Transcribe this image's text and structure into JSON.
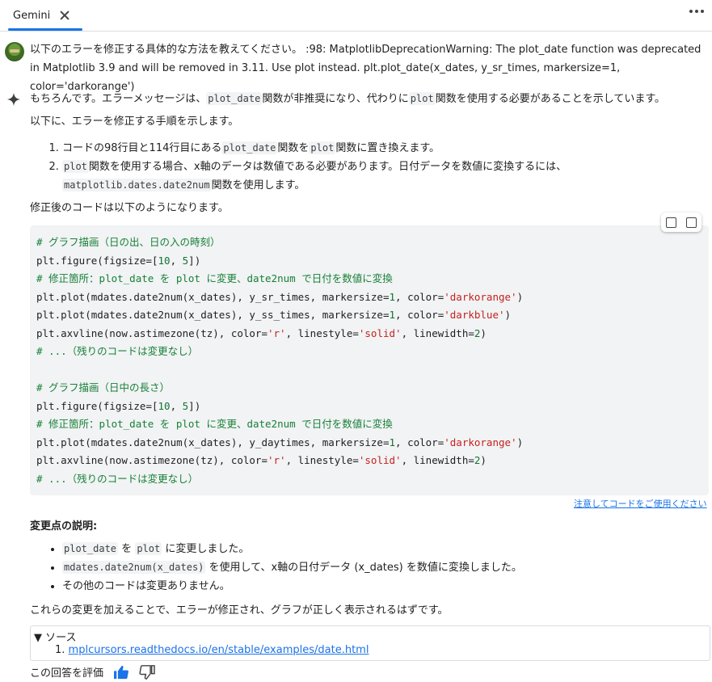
{
  "tab": {
    "title": "Gemini"
  },
  "prompt": {
    "text": "以下のエラーを修正する具体的な方法を教えてください。 :98: MatplotlibDeprecationWarning: The plot_date function was deprecated in Matplotlib 3.9 and will be removed in 3.11. Use plot instead. plt.plot_date(x_dates, y_sr_times, markersize=1, color='darkorange')"
  },
  "response": {
    "p1_a": "もちろんです。エラーメッセージは、",
    "p1_code1": "plot_date",
    "p1_b": "関数が非推奨になり、代わりに",
    "p1_code2": "plot",
    "p1_c": "関数を使用する必要があることを示しています。",
    "p2": "以下に、エラーを修正する手順を示します。",
    "step1_a": "コードの98行目と114行目にある",
    "step1_code1": "plot_date",
    "step1_b": "関数を",
    "step1_code2": "plot",
    "step1_c": "関数に置き換えます。",
    "step2_code1": "plot",
    "step2_a": "関数を使用する場合、x軸のデータは数値である必要があります。日付データを数値に変換するには、",
    "step2_code2": "matplotlib.dates.date2num",
    "step2_b": "関数を使用します。",
    "p3": "修正後のコードは以下のようになります。",
    "caution_link": "注意してコードをご使用ください",
    "changes_heading": "変更点の説明:",
    "bullet1_code1": "plot_date",
    "bullet1_a": "を",
    "bullet1_code2": "plot",
    "bullet1_b": "に変更しました。",
    "bullet2_code": "mdates.date2num(x_dates)",
    "bullet2_a": "を使用して、x軸の日付データ (x_dates) を数値に変換しました。",
    "bullet3": "その他のコードは変更ありません。",
    "conclusion": "これらの変更を加えることで、エラーが修正され、グラフが正しく表示されるはずです。"
  },
  "code": {
    "l1": "# グラフ描画（日の出、日の入の時刻）",
    "l2a": "plt.figure(figsize=[",
    "l2n1": "10",
    "l2b": ", ",
    "l2n2": "5",
    "l2c": "])",
    "l3": "# 修正箇所：plot_date を plot に変更、date2num で日付を数値に変換",
    "l4a": "plt.plot(mdates.date2num(x_dates), y_sr_times, markersize=",
    "l4n": "1",
    "l4b": ", color=",
    "l4s": "'darkorange'",
    "l4c": ")",
    "l5a": "plt.plot(mdates.date2num(x_dates), y_ss_times, markersize=",
    "l5n": "1",
    "l5b": ", color=",
    "l5s": "'darkblue'",
    "l5c": ")",
    "l6a": "plt.axvline(now.astimezone(tz), color=",
    "l6s1": "'r'",
    "l6b": ", linestyle=",
    "l6s2": "'solid'",
    "l6c": ", linewidth=",
    "l6n": "2",
    "l6d": ")",
    "l7": "# ...（残りのコードは変更なし）",
    "l9": "# グラフ描画（日中の長さ）",
    "l10a": "plt.figure(figsize=[",
    "l10n1": "10",
    "l10b": ", ",
    "l10n2": "5",
    "l10c": "])",
    "l11": "# 修正箇所：plot_date を plot に変更、date2num で日付を数値に変換",
    "l12a": "plt.plot(mdates.date2num(x_dates), y_daytimes, markersize=",
    "l12n": "1",
    "l12b": ", color=",
    "l12s": "'darkorange'",
    "l12c": ")",
    "l13a": "plt.axvline(now.astimezone(tz), color=",
    "l13s1": "'r'",
    "l13b": ", linestyle=",
    "l13s2": "'solid'",
    "l13c": ", linewidth=",
    "l13n": "2",
    "l13d": ")",
    "l14": "# ...（残りのコードは変更なし）"
  },
  "sources": {
    "summary": "▼ ソース",
    "items": [
      {
        "num": "1.",
        "text": "mplcursors.readthedocs.io/en/stable/examples/date.html"
      }
    ]
  },
  "rating": {
    "label": "この回答を評価"
  },
  "colors": {
    "accent": "#1a73e8",
    "comment": "#188038",
    "string": "#c5221f"
  }
}
